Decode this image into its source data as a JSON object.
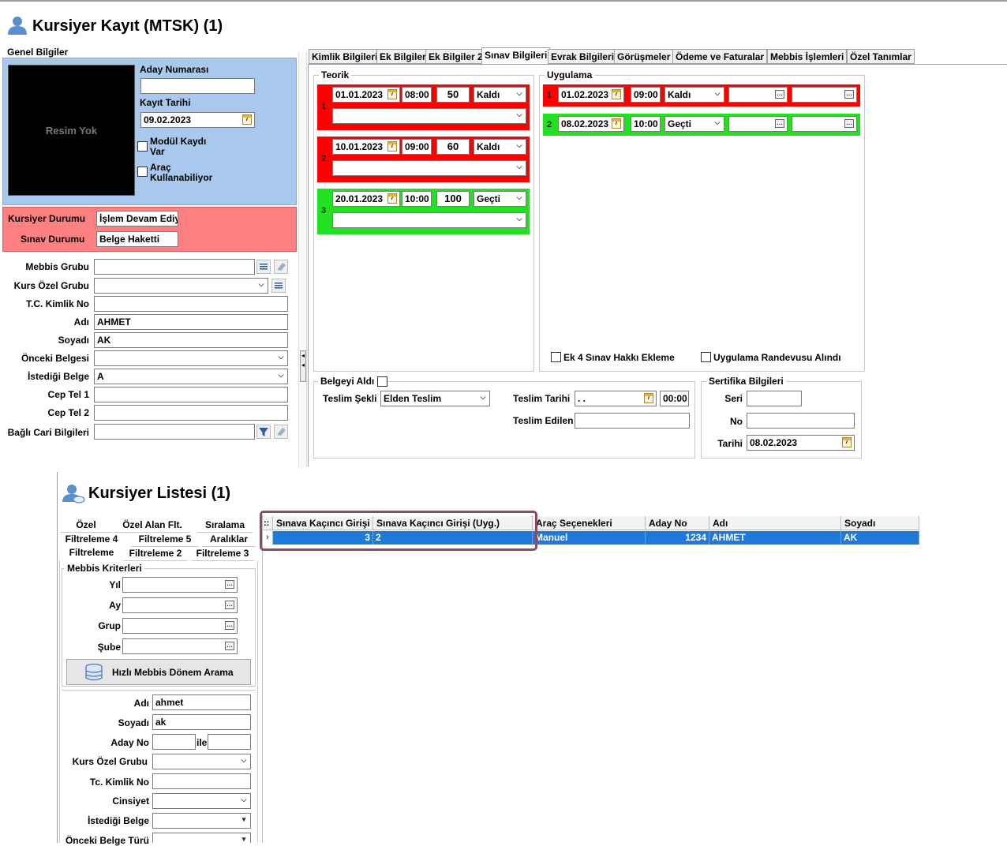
{
  "colors": {
    "blue_panel": "#a8c8ee",
    "red_panel": "#ff8080",
    "exam_red": "#ff0000",
    "exam_green": "#22e022",
    "grid_selected": "#1e7ad6",
    "highlight": "#8b4a68"
  },
  "window1": {
    "title": "Kursiyer Kayıt (MTSK) (1)",
    "icon": "users-icon"
  },
  "genel": {
    "title": "Genel Bilgiler",
    "photo_text": "Resim Yok",
    "aday_no_label": "Aday Numarası",
    "aday_no": "",
    "kayit_tarihi_label": "Kayıt Tarihi",
    "kayit_tarihi": "09.02.2023",
    "modul_line1": "Modül Kaydı",
    "modul_line2": "Var",
    "arac_line1": "Araç",
    "arac_line2": "Kullanabiliyor",
    "kursiyer_durumu_label": "Kursiyer Durumu",
    "kursiyer_durumu": "İşlem Devam Ediy",
    "sinav_durumu_label": "Sınav Durumu",
    "sinav_durumu": "Belge Haketti",
    "fields": [
      {
        "label": "Mebbis Grubu",
        "value": ""
      },
      {
        "label": "Kurs Özel Grubu",
        "value": ""
      },
      {
        "label": "T.C. Kimlik No",
        "value": ""
      },
      {
        "label": "Adı",
        "value": "AHMET"
      },
      {
        "label": "Soyadı",
        "value": "AK"
      },
      {
        "label": "Önceki Belgesi",
        "value": ""
      },
      {
        "label": "İstediği Belge",
        "value": "A"
      },
      {
        "label": "Cep Tel 1",
        "value": ""
      },
      {
        "label": "Cep Tel 2",
        "value": ""
      },
      {
        "label": "Bağlı Cari Bilgileri",
        "value": ""
      }
    ]
  },
  "tabs": [
    "Kimlik Bilgileri",
    "Ek Bilgiler",
    "Ek Bilgiler 2",
    "Sınav Bilgileri",
    "Evrak Bilgileri",
    "Görüşmeler",
    "Ödeme ve Faturalar",
    "Mebbis İşlemleri",
    "Özel Tanımlar"
  ],
  "teorik": {
    "title": "Teorik",
    "rows": [
      {
        "num": "1",
        "date": "01.01.2023",
        "time": "08:00",
        "score": "50",
        "result": "Kaldı",
        "status": "red"
      },
      {
        "num": "2",
        "date": "10.01.2023",
        "time": "09:00",
        "score": "60",
        "result": "Kaldı",
        "status": "red"
      },
      {
        "num": "3",
        "date": "20.01.2023",
        "time": "10:00",
        "score": "100",
        "result": "Geçti",
        "status": "green"
      }
    ]
  },
  "uygulama": {
    "title": "Uygulama",
    "rows": [
      {
        "num": "1",
        "date": "01.02.2023",
        "time": "09:00",
        "result": "Kaldı",
        "status": "red"
      },
      {
        "num": "2",
        "date": "08.02.2023",
        "time": "10:00",
        "result": "Geçti",
        "status": "green"
      }
    ],
    "ek4_label": "Ek 4 Sınav Hakkı Ekleme",
    "randevu_label": "Uygulama Randevusu Alındı"
  },
  "belge": {
    "title": "Belgeyi Aldı",
    "teslim_sekli_label": "Teslim Şekli",
    "teslim_sekli": "Elden Teslim",
    "teslim_tarihi_label": "Teslim Tarihi",
    "teslim_tarihi": " . .",
    "teslim_saat": "00:00",
    "teslim_edilen_label": "Teslim Edilen",
    "teslim_edilen": ""
  },
  "sertifika": {
    "title": "Sertifika Bilgileri",
    "seri_label": "Seri",
    "seri": "",
    "no_label": "No",
    "no": "",
    "tarih_label": "Tarihi",
    "tarih": "08.02.2023"
  },
  "window2": {
    "title": "Kursiyer Listesi (1)",
    "icon": "users-icon"
  },
  "filter_tabs": {
    "row1": [
      "Özel",
      "Özel Alan Flt.",
      "Sıralama"
    ],
    "row2": [
      "Filtreleme 4",
      "Filtreleme 5",
      "Aralıklar"
    ],
    "row3": [
      "Filtreleme",
      "Filtreleme 2",
      "Filtreleme 3"
    ]
  },
  "mebbis": {
    "title": "Mebbis Kriterleri",
    "yil_label": "Yıl",
    "ay_label": "Ay",
    "grup_label": "Grup",
    "sube_label": "Şube",
    "yil": "",
    "ay": "",
    "grup": "",
    "sube": "",
    "search_button": "Hızlı Mebbis Dönem Arama"
  },
  "filters": {
    "adi_label": "Adı",
    "adi": "ahmet",
    "soyadi_label": "Soyadı",
    "soyadi": "ak",
    "aday_no_label": "Aday No",
    "aday_no_from": "",
    "ile": "ile",
    "aday_no_to": "",
    "kurs_ozel_label": "Kurs Özel Grubu",
    "kurs_ozel": "",
    "tc_label": "Tc. Kimlik No",
    "tc": "",
    "cinsiyet_label": "Cinsiyet",
    "cinsiyet": "",
    "istedigi_label": "İstediği Belge",
    "istedigi": "",
    "onceki_label": "Önceki Belge Türü",
    "onceki": ""
  },
  "grid": {
    "row_indicator": "::",
    "headers": [
      "Sınava Kaçıncı Girişi",
      "Sınava Kaçıncı Girişi (Uyg.)",
      "Araç Seçenekleri",
      "Aday No",
      "Adı",
      "Soyadı"
    ],
    "rows": [
      [
        "3",
        "2",
        "Manuel",
        "1234",
        "AHMET",
        "AK"
      ]
    ]
  }
}
